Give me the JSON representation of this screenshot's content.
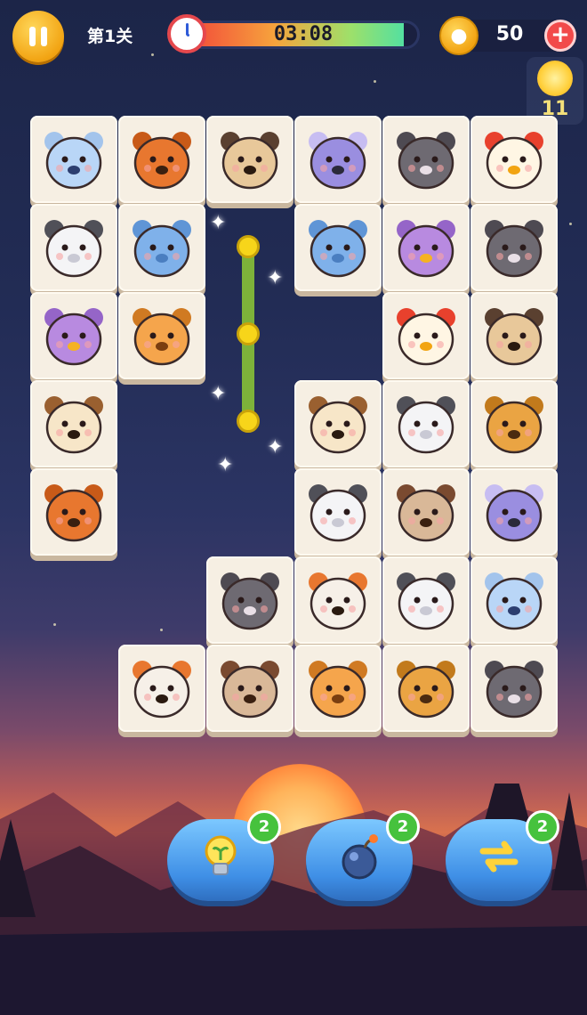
{
  "header": {
    "level_label": "第1关",
    "timer_text": "03:08",
    "timer_progress": 0.94,
    "coins": "50",
    "sun_count": "11"
  },
  "board": {
    "rows": [
      [
        "polar-bear",
        "squirrel",
        "pug",
        "koala",
        "donkey",
        "chicken"
      ],
      [
        "zebra",
        "elephant",
        "",
        "elephant",
        "owl",
        "donkey"
      ],
      [
        "owl",
        "giraffe",
        "",
        "",
        "chicken",
        "pug"
      ],
      [
        "hedgehog",
        "",
        "",
        "hedgehog",
        "zebra",
        "teddy-bear"
      ],
      [
        "squirrel",
        "",
        "",
        "zebra",
        "gorilla",
        "koala"
      ],
      [
        "",
        "",
        "donkey",
        "red-panda",
        "zebra",
        "polar-bear"
      ],
      [
        "",
        "red-panda",
        "gorilla",
        "giraffe",
        "teddy-bear",
        "donkey"
      ]
    ]
  },
  "powerups": [
    {
      "name": "hint",
      "icon": "lightbulb-icon",
      "count": "2"
    },
    {
      "name": "bomb",
      "icon": "bomb-icon",
      "count": "2"
    },
    {
      "name": "shuffle",
      "icon": "shuffle-icon",
      "count": "2"
    }
  ],
  "colors": {
    "tile": "#f6efe3",
    "badge": "#46c23d",
    "power": "#3f8fe6"
  }
}
